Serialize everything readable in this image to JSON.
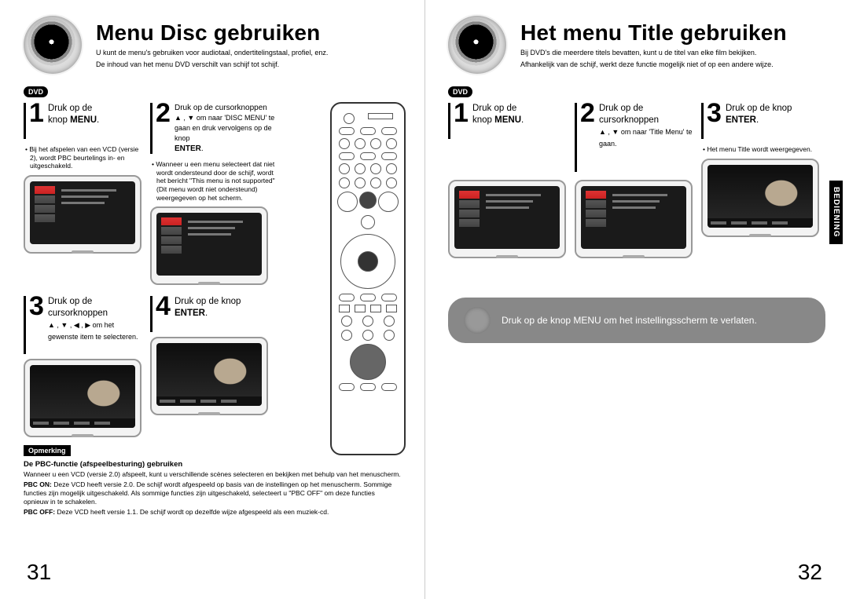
{
  "left": {
    "title": "Menu Disc gebruiken",
    "intro1": "U kunt de menu's gebruiken voor audiotaal, ondertitelingstaal, profiel, enz.",
    "intro2": "De inhoud van het menu DVD verschilt van schijf tot schijf.",
    "badge": "DVD",
    "step1": {
      "num": "1",
      "text_a": "Druk op de",
      "text_b": "knop ",
      "bold": "MENU",
      "text_c": "."
    },
    "bullet1": "Bij het afspelen van een VCD (versie 2), wordt PBC beurtelings in- en uitgeschakeld.",
    "step2": {
      "num": "2",
      "line1": "Druk op de cursorknoppen",
      "line2": "▲ , ▼ om naar 'DISC MENU' te gaan en druk vervolgens op de knop",
      "bold": "ENTER",
      "tail": "."
    },
    "bullet2": "Wanneer u een menu selecteert dat niet wordt ondersteund door de schijf, wordt het bericht \"This menu is not supported\" (Dit menu wordt niet ondersteund) weergegeven op het scherm.",
    "step3": {
      "num": "3",
      "line1": "Druk op de",
      "line2": "cursorknoppen",
      "line3": "▲ , ▼ , ◀ , ▶ om het gewenste item te selecteren."
    },
    "step4": {
      "num": "4",
      "line1": "Druk op de knop",
      "bold": "ENTER",
      "tail": "."
    },
    "opm": "Opmerking",
    "note_title": "De PBC-functie (afspeelbesturing) gebruiken",
    "note_body": "Wanneer u een VCD (versie 2.0) afspeelt, kunt u verschillende scènes selecteren en bekijken met behulp van het menuscherm.",
    "pbc_on_lbl": "PBC ON:",
    "pbc_on": "Deze VCD heeft versie 2.0. De schijf wordt afgespeeld op basis van de instellingen op het menuscherm. Sommige functies zijn mogelijk uitgeschakeld. Als sommige functies zijn uitgeschakeld, selecteert u \"PBC OFF\" om deze functies opnieuw in te schakelen.",
    "pbc_off_lbl": "PBC OFF:",
    "pbc_off": "Deze VCD heeft versie 1.1. De schijf wordt op dezelfde wijze afgespeeld als een muziek-cd.",
    "page": "31"
  },
  "right": {
    "title": "Het menu Title gebruiken",
    "intro1": "Bij DVD's die meerdere titels bevatten, kunt u de titel van elke film bekijken.",
    "intro2": "Afhankelijk van de schijf, werkt deze functie mogelijk niet of op een andere wijze.",
    "badge": "DVD",
    "step1": {
      "num": "1",
      "text_a": "Druk op de",
      "text_b": "knop ",
      "bold": "MENU",
      "text_c": "."
    },
    "step2": {
      "num": "2",
      "line1": "Druk op de",
      "line2": "cursorknoppen",
      "line3": "▲ , ▼ om naar 'Title Menu' te gaan."
    },
    "step3": {
      "num": "3",
      "line1": "Druk op de knop",
      "bold": "ENTER",
      "tail": "."
    },
    "bullet3": "Het menu Title wordt weergegeven.",
    "exit": "Druk op de knop MENU om het instellingsscherm te verlaten.",
    "sidetab": "BEDIENING",
    "page": "32"
  }
}
